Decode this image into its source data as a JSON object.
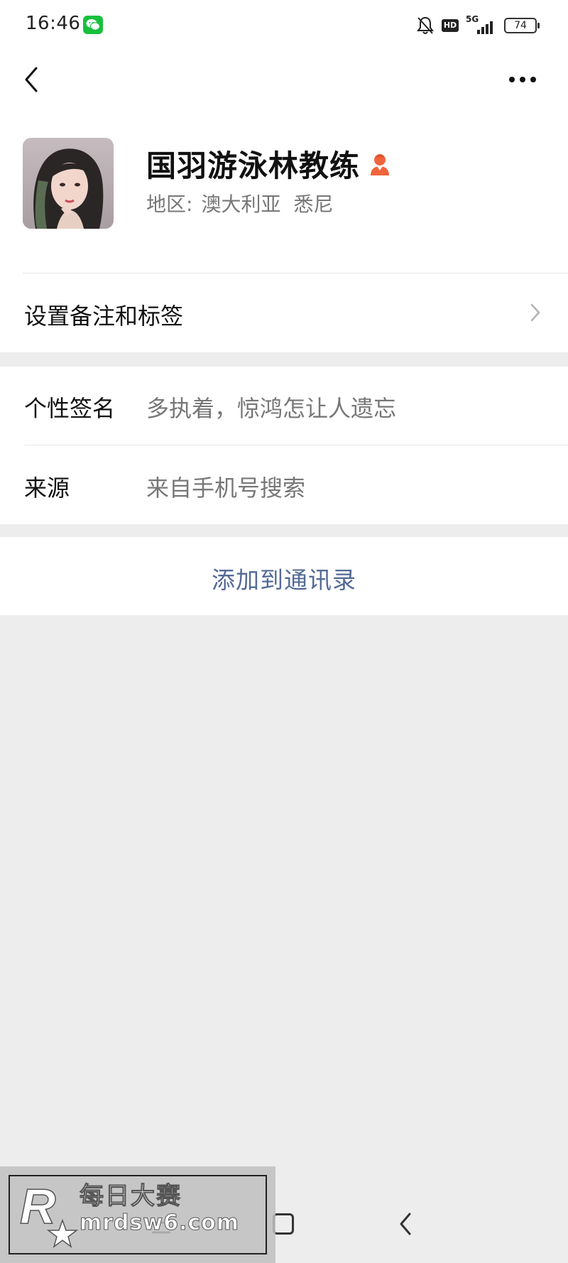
{
  "status_bar": {
    "time": "16:46",
    "hd_badge": "HD",
    "network": "5G",
    "battery": "74"
  },
  "nav": {
    "back_icon": "chevron-left-icon",
    "more_icon": "more-dots-icon"
  },
  "profile": {
    "name": "国羽游泳林教练",
    "gender": "female",
    "region_label": "地区:",
    "region_country": "澳大利亚",
    "region_city": "悉尼"
  },
  "remark": {
    "label": "设置备注和标签"
  },
  "info": {
    "signature_label": "个性签名",
    "signature_value": "多执着，惊鸿怎让人遗忘",
    "source_label": "来源",
    "source_value": "来自手机号搜索"
  },
  "actions": {
    "add_contact": "添加到通讯录"
  },
  "watermark": {
    "title": "每日大赛",
    "url": "mrdsw6.com"
  },
  "colors": {
    "link": "#536a96",
    "female_icon": "#f0643c",
    "wechat_green": "#18c03c",
    "page_bg": "#ededed"
  }
}
